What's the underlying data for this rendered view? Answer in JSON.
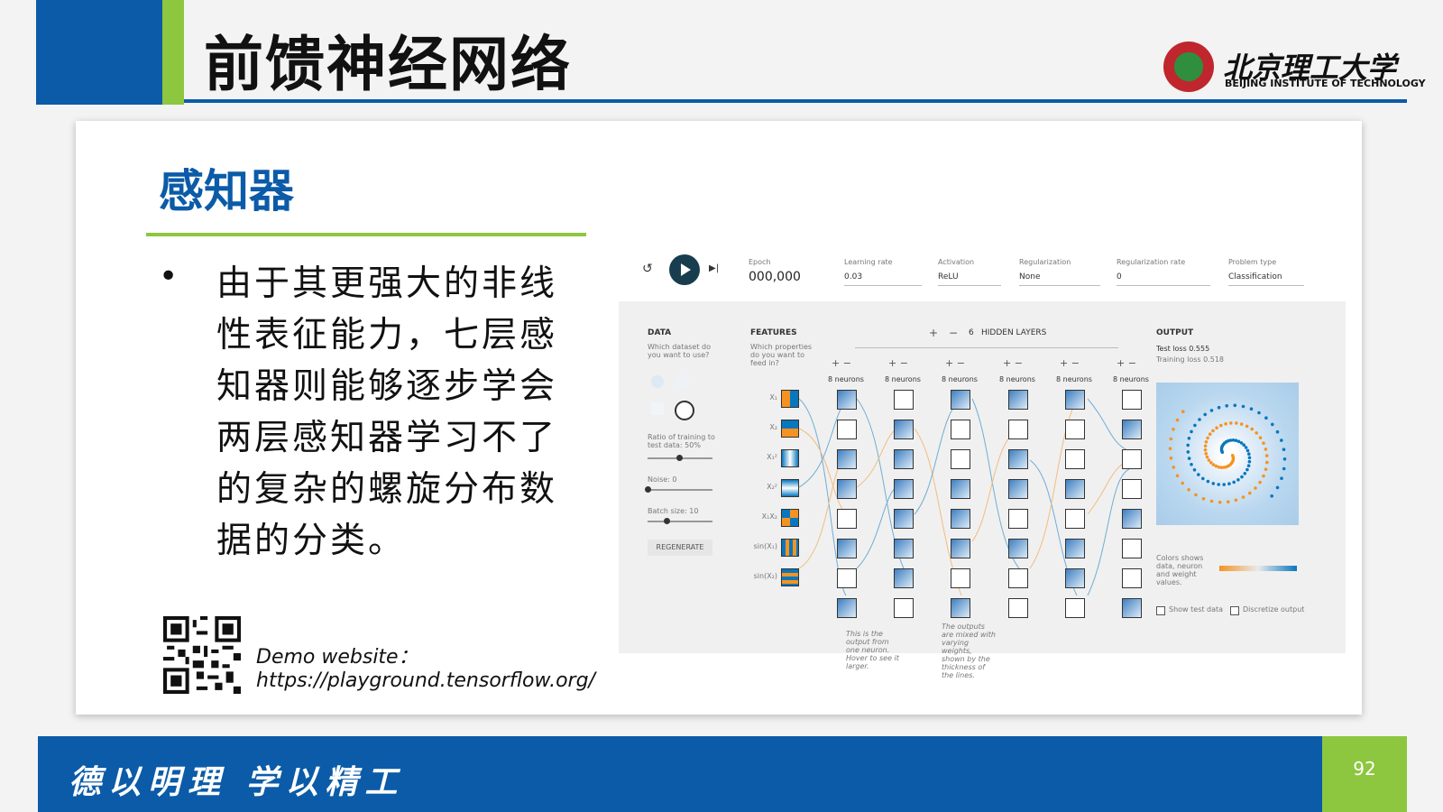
{
  "header": {
    "title": "前馈神经网络",
    "logo_cn": "北京理工大学",
    "logo_en": "BEIJING INSTITUTE OF TECHNOLOGY"
  },
  "section": {
    "title": "感知器"
  },
  "body": {
    "bullet": "•",
    "text": "由于其更强大的非线性表征能力，七层感知器则能够逐步学会两层感知器学习不了的复杂的螺旋分布数据的分类。"
  },
  "demo": {
    "label": "Demo website：",
    "url": "https://playground.tensorflow.org/"
  },
  "footer": {
    "motto": "德以明理  学以精工",
    "page": "92"
  },
  "playground": {
    "epoch_label": "Epoch",
    "epoch_value": "000,000",
    "lr_label": "Learning rate",
    "lr_value": "0.03",
    "act_label": "Activation",
    "act_value": "ReLU",
    "reg_label": "Regularization",
    "reg_value": "None",
    "regrate_label": "Regularization rate",
    "regrate_value": "0",
    "ptype_label": "Problem type",
    "ptype_value": "Classification",
    "data_title": "DATA",
    "data_sub": "Which dataset do you want to use?",
    "ratio_label": "Ratio of training to test data:  50%",
    "noise_label": "Noise:  0",
    "batch_label": "Batch size:  10",
    "regen": "REGENERATE",
    "features_title": "FEATURES",
    "features_sub": "Which properties do you want to feed in?",
    "features": [
      "X₁",
      "X₂",
      "X₁²",
      "X₂²",
      "X₁X₂",
      "sin(X₁)",
      "sin(X₂)"
    ],
    "hidden_count": "6",
    "hidden_label": "HIDDEN LAYERS",
    "neurons_label": "8 neurons",
    "output_title": "OUTPUT",
    "test_loss": "Test loss 0.555",
    "train_loss": "Training loss 0.518",
    "colors_note": "Colors shows data, neuron and weight values.",
    "show_test": "Show test data",
    "discretize": "Discretize output",
    "note1": "This is the output from one neuron. Hover to see it larger.",
    "note2": "The outputs are mixed with varying weights, shown by the thickness of the lines."
  }
}
